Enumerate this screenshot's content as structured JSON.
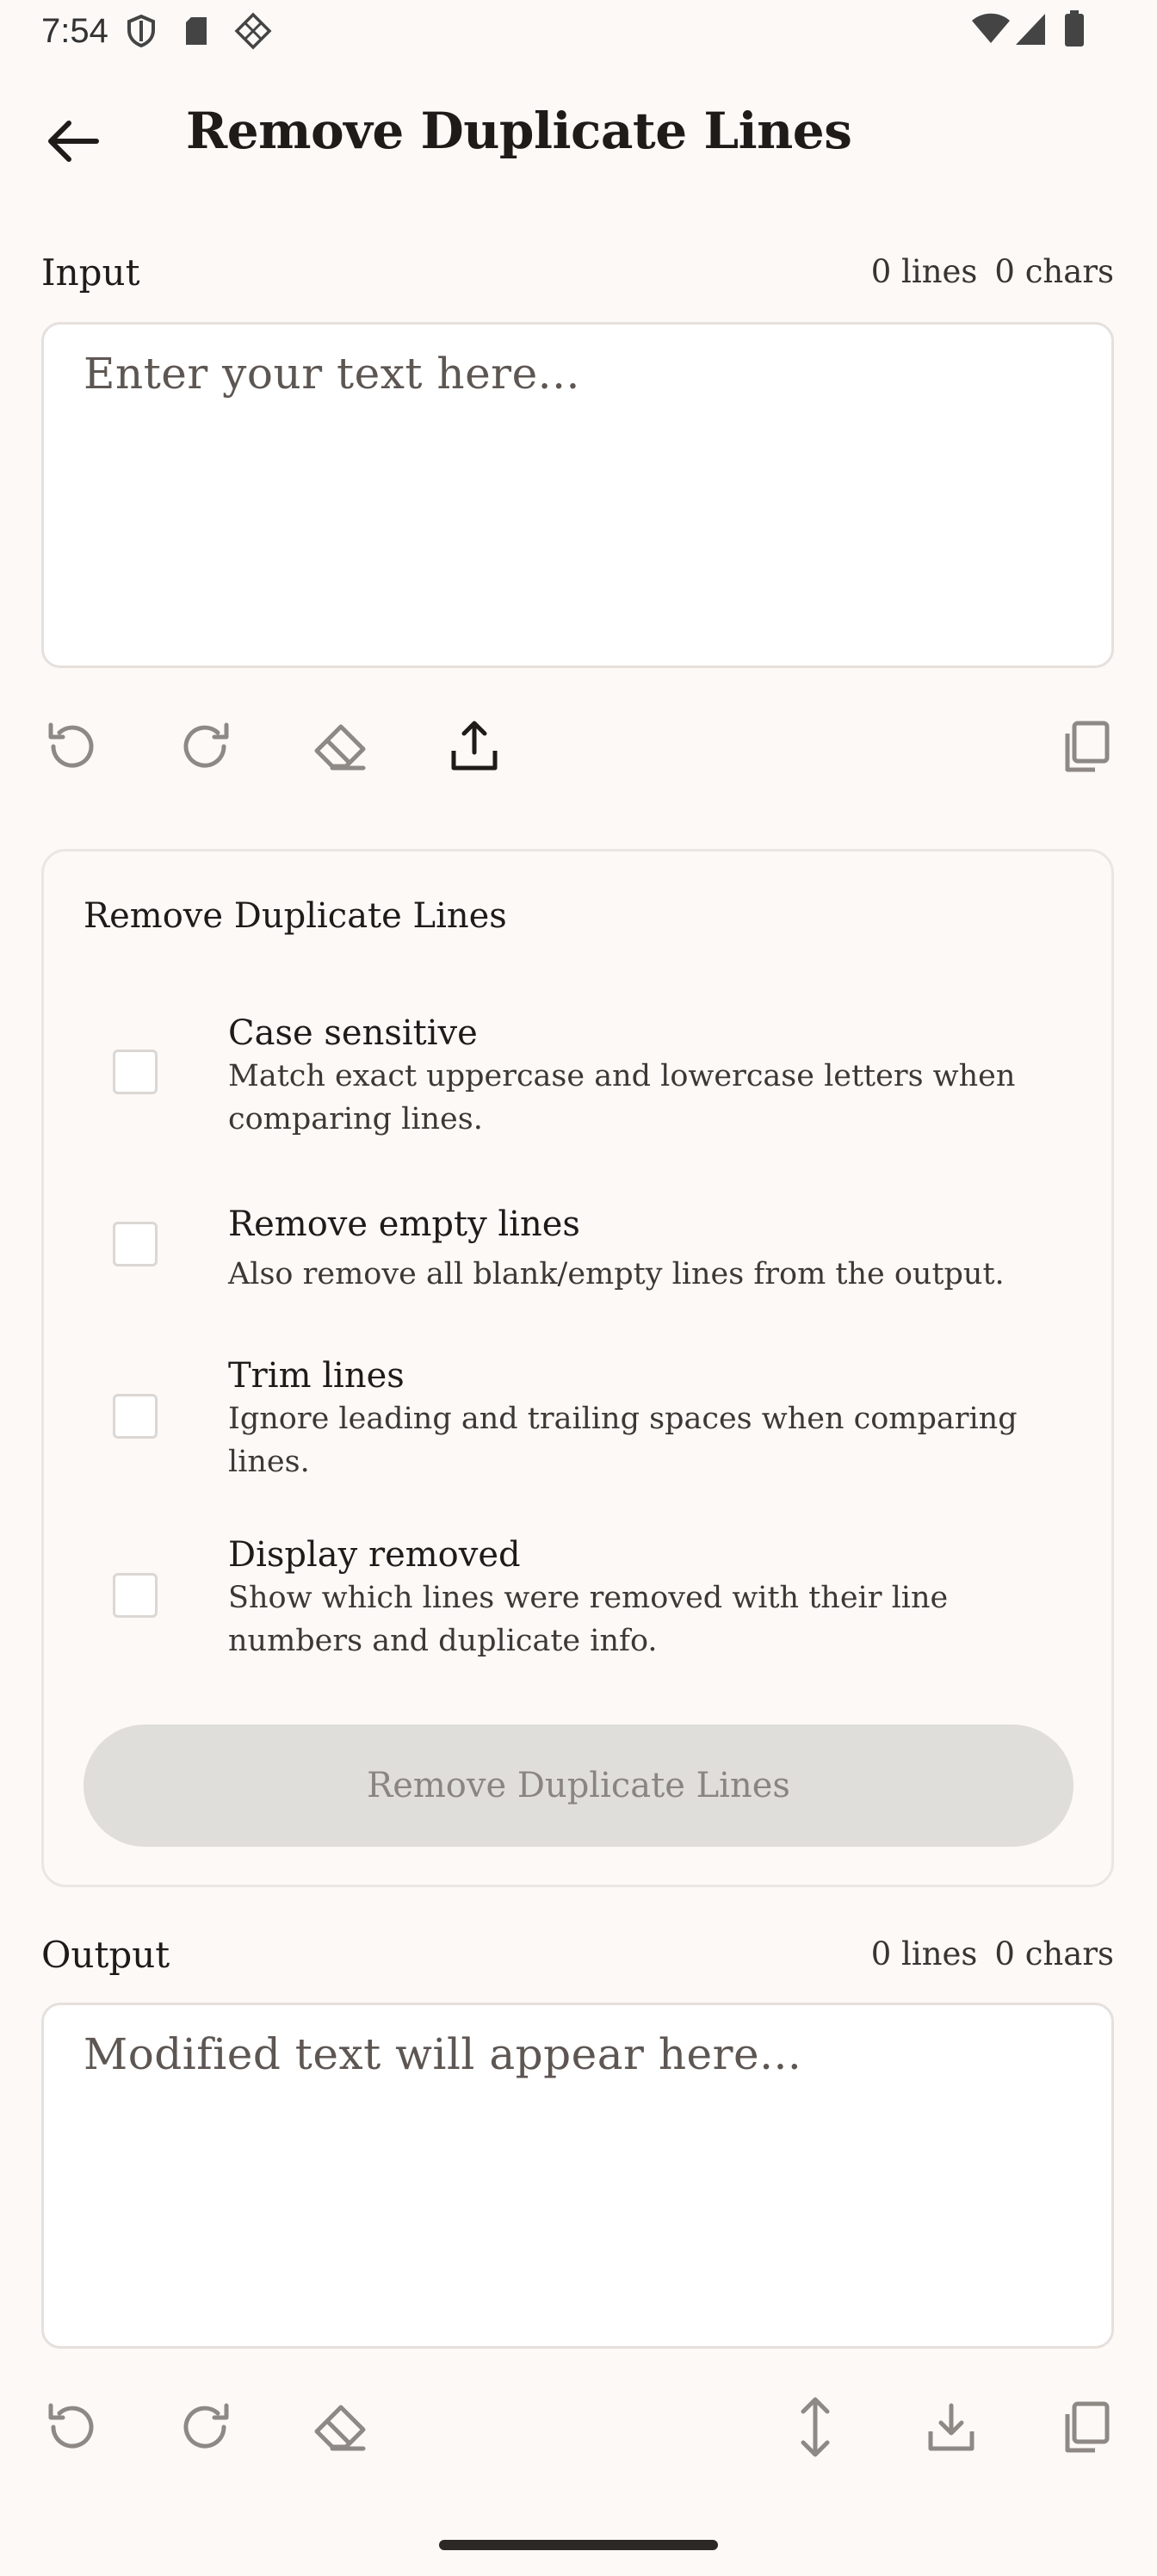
{
  "status_bar": {
    "time": "7:54"
  },
  "app_bar": {
    "title": "Remove Duplicate Lines"
  },
  "input": {
    "label": "Input",
    "lines_count": "0 lines",
    "chars_count": "0 chars",
    "placeholder": "Enter your text here..."
  },
  "options_card": {
    "title": "Remove Duplicate Lines",
    "options": [
      {
        "title": "Case sensitive",
        "description": "Match exact uppercase and lowercase letters when comparing lines.",
        "checked": false
      },
      {
        "title": "Remove empty lines",
        "description": "Also remove all blank/empty lines from the output.",
        "checked": false
      },
      {
        "title": "Trim lines",
        "description": "Ignore leading and trailing spaces when comparing lines.",
        "checked": false
      },
      {
        "title": "Display removed",
        "description": "Show which lines were removed with their line numbers and duplicate info.",
        "checked": false
      }
    ],
    "action_label": "Remove Duplicate Lines"
  },
  "output": {
    "label": "Output",
    "lines_count": "0 lines",
    "chars_count": "0 chars",
    "placeholder": "Modified text will appear here..."
  },
  "colors": {
    "background": "#fcf9f7",
    "disabled_button": "#e0dedb",
    "icon_muted": "#8f8985",
    "icon_active": "#1f1b18"
  },
  "icons": {
    "input_tools": [
      "undo-icon",
      "redo-icon",
      "eraser-icon",
      "share-icon",
      "copy-icon"
    ],
    "output_tools": [
      "undo-icon",
      "redo-icon",
      "eraser-icon",
      "swap-vertical-icon",
      "download-icon",
      "copy-icon"
    ]
  }
}
